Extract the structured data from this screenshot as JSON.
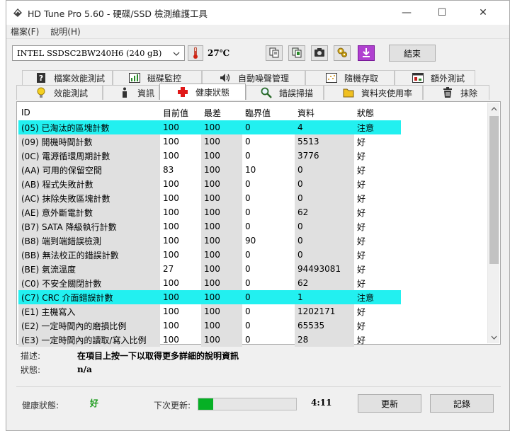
{
  "window": {
    "title": "HD Tune Pro 5.60 - 硬碟/SSD 檢測維護工具",
    "min_label": "—",
    "max_label": "☐",
    "close_label": "✕"
  },
  "menu": [
    "檔案(F)",
    "說明(H)"
  ],
  "toolbar": {
    "drive": "INTEL SSDSC2BW240H6 (240 gB)",
    "temperature": "27℃",
    "exit_label": "結束"
  },
  "tabs": {
    "row1": [
      "檔案效能測試",
      "磁碟監控",
      "自動噪聲管理",
      "隨機存取",
      "額外測試"
    ],
    "row2": [
      "效能測試",
      "資訊",
      "健康狀態",
      "錯誤掃描",
      "資料夾使用率",
      "抹除"
    ],
    "active": "健康狀態"
  },
  "table": {
    "headers": [
      "ID",
      "目前值",
      "最差",
      "臨界值",
      "資料",
      "狀態"
    ],
    "rows": [
      {
        "id": "(05) 已淘汰的區塊計數",
        "cur": "100",
        "worst": "100",
        "thr": "0",
        "data": "4",
        "status": "注意",
        "hl": true
      },
      {
        "id": "(09) 開機時間計數",
        "cur": "100",
        "worst": "100",
        "thr": "0",
        "data": "5513",
        "status": "好",
        "hl": false
      },
      {
        "id": "(0C) 電源循環周期計數",
        "cur": "100",
        "worst": "100",
        "thr": "0",
        "data": "3776",
        "status": "好",
        "hl": false
      },
      {
        "id": "(AA) 可用的保留空間",
        "cur": "83",
        "worst": "100",
        "thr": "10",
        "data": "0",
        "status": "好",
        "hl": false
      },
      {
        "id": "(AB) 程式失敗計數",
        "cur": "100",
        "worst": "100",
        "thr": "0",
        "data": "0",
        "status": "好",
        "hl": false
      },
      {
        "id": "(AC) 抹除失敗區塊計數",
        "cur": "100",
        "worst": "100",
        "thr": "0",
        "data": "0",
        "status": "好",
        "hl": false
      },
      {
        "id": "(AE) 意外斷電計數",
        "cur": "100",
        "worst": "100",
        "thr": "0",
        "data": "62",
        "status": "好",
        "hl": false
      },
      {
        "id": "(B7) SATA 降級執行計數",
        "cur": "100",
        "worst": "100",
        "thr": "0",
        "data": "0",
        "status": "好",
        "hl": false
      },
      {
        "id": "(B8) 端到端錯誤檢測",
        "cur": "100",
        "worst": "100",
        "thr": "90",
        "data": "0",
        "status": "好",
        "hl": false
      },
      {
        "id": "(BB) 無法校正的錯誤計數",
        "cur": "100",
        "worst": "100",
        "thr": "0",
        "data": "0",
        "status": "好",
        "hl": false
      },
      {
        "id": "(BE) 氣流溫度",
        "cur": "27",
        "worst": "100",
        "thr": "0",
        "data": "94493081",
        "status": "好",
        "hl": false
      },
      {
        "id": "(C0) 不安全關閉計數",
        "cur": "100",
        "worst": "100",
        "thr": "0",
        "data": "62",
        "status": "好",
        "hl": false
      },
      {
        "id": "(C7) CRC 介面錯誤計數",
        "cur": "100",
        "worst": "100",
        "thr": "0",
        "data": "1",
        "status": "注意",
        "hl": true
      },
      {
        "id": "(E1) 主機寫入",
        "cur": "100",
        "worst": "100",
        "thr": "0",
        "data": "1202171",
        "status": "好",
        "hl": false
      },
      {
        "id": "(E2) 一定時間內的磨損比例",
        "cur": "100",
        "worst": "100",
        "thr": "0",
        "data": "65535",
        "status": "好",
        "hl": false
      },
      {
        "id": "(E3) 一定時間內的讀取/寫入比例",
        "cur": "100",
        "worst": "100",
        "thr": "0",
        "data": "28",
        "status": "好",
        "hl": false
      }
    ]
  },
  "description": {
    "desc_label": "描述:",
    "desc_value": "在項目上按一下以取得更多詳細的說明資訊",
    "status_label": "狀態:",
    "status_value": "n/a"
  },
  "bottom": {
    "health_label": "健康狀態:",
    "health_value": "好",
    "next_label": "下次更新:",
    "progress": 0.15,
    "countdown": "4:11",
    "refresh_label": "更新",
    "log_label": "記錄"
  },
  "colors": {
    "highlight": "#22f0f0",
    "good": "#1a9a1a",
    "progress": "#06b025"
  }
}
